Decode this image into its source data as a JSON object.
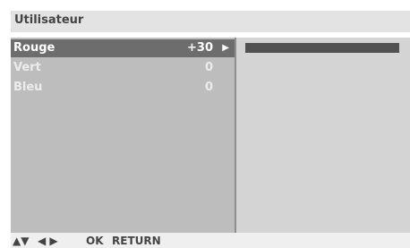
{
  "header": {
    "title": "Utilisateur"
  },
  "menu": {
    "items": [
      {
        "label": "Rouge",
        "value": "+30",
        "arrow": "▶"
      },
      {
        "label": "Vert",
        "value": "0"
      },
      {
        "label": "Bleu",
        "value": "0"
      }
    ],
    "selected_index": 0
  },
  "slider": {
    "level_fraction": 1.0
  },
  "footer": {
    "up_down": "▲▼",
    "left_right": "◀ ▶",
    "ok": "OK",
    "return": "RETURN"
  },
  "colors": {
    "title_bg": "#e3e3e3",
    "panel_bg": "#bdbdbd",
    "selected_bg": "#6d6d6d",
    "bar_fill": "#525252"
  }
}
